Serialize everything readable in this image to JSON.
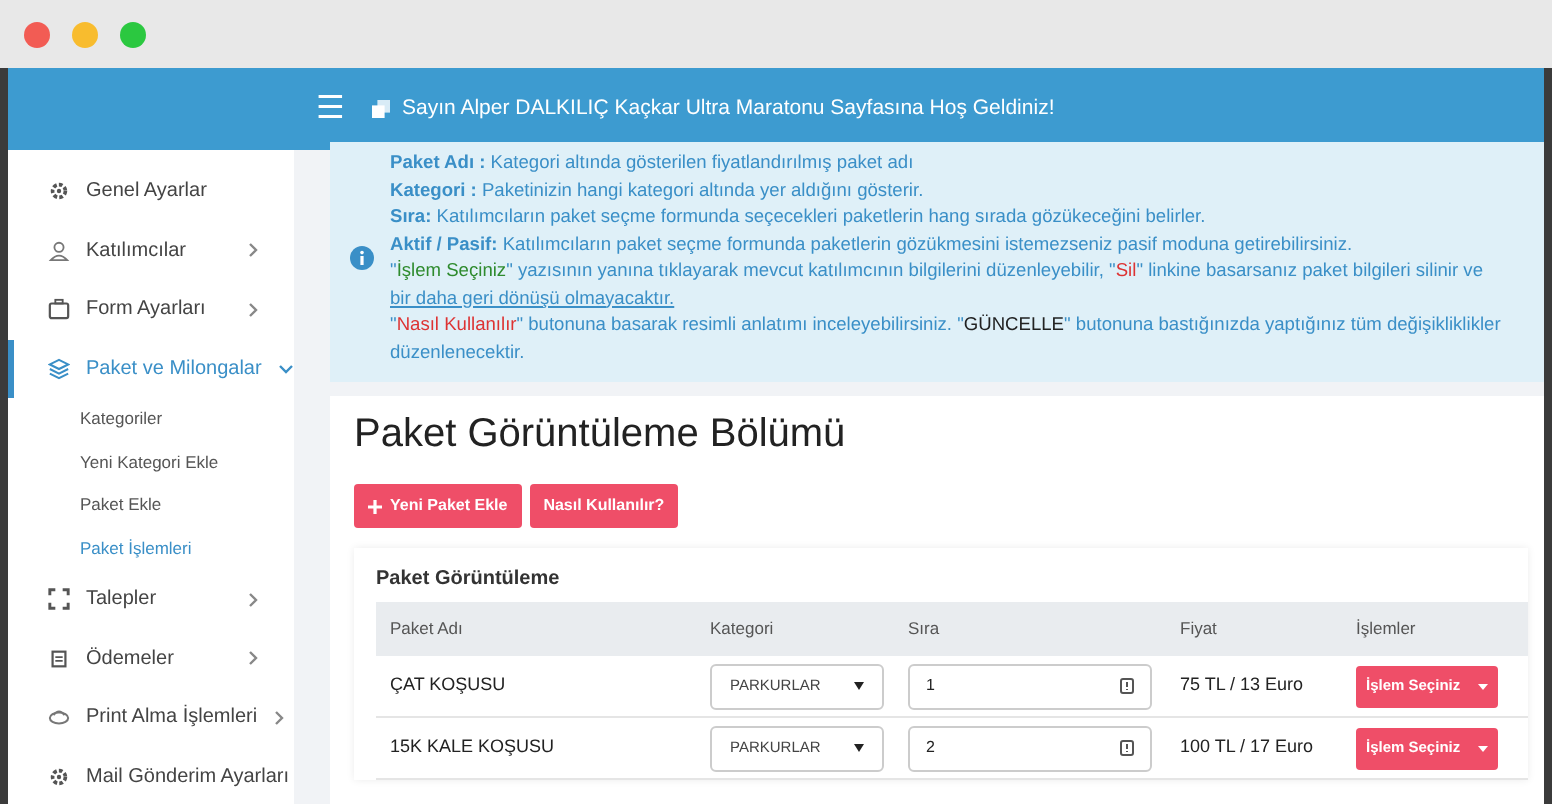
{
  "header": {
    "menu_icon": "☰",
    "welcome": "Sayın Alper DALKILIÇ Kaçkar Ultra Maratonu Sayfasına Hoş Geldiniz!"
  },
  "sidebar": {
    "items": [
      {
        "label": "Genel Ayarlar",
        "selected": false
      },
      {
        "label": "Katılımcılar",
        "selected": false,
        "expanded": false
      },
      {
        "label": "Form Ayarları",
        "selected": false,
        "expanded": false
      },
      {
        "label": "Paket ve Milongalar",
        "selected": true,
        "expanded": true,
        "children": [
          {
            "label": "Kategoriler",
            "selected": false
          },
          {
            "label": "Yeni Kategori Ekle",
            "selected": false
          },
          {
            "label": "Paket Ekle",
            "selected": false
          },
          {
            "label": "Paket İşlemleri",
            "selected": true
          }
        ]
      },
      {
        "label": "Talepler",
        "selected": false,
        "expanded": false
      },
      {
        "label": "Ödemeler",
        "selected": false,
        "expanded": false
      },
      {
        "label": "Print Alma İşlemleri",
        "selected": false,
        "expanded": false
      },
      {
        "label": "Mail Gönderim Ayarları",
        "selected": false
      }
    ]
  },
  "info": {
    "lines": [
      [
        {
          "kind": "label",
          "text": "Paket Adı :"
        },
        {
          "kind": "plain",
          "text": " Kategori altında gösterilen fiyatlandırılmış paket adı"
        }
      ],
      [
        {
          "kind": "label",
          "text": "Kategori :"
        },
        {
          "kind": "plain",
          "text": " Paketinizin hangi kategori altında yer aldığını gösterir."
        }
      ],
      [
        {
          "kind": "label",
          "text": "Sıra:"
        },
        {
          "kind": "plain",
          "text": " Katılımcıların paket seçme formunda seçecekleri paketlerin hang sırada gözükeceğini belirler."
        }
      ],
      [
        {
          "kind": "label",
          "text": "Aktif / Pasif:"
        },
        {
          "kind": "plain",
          "text": " Katılımcıların paket seçme formunda paketlerin gözükmesini istemezseniz pasif moduna getirebilirsiniz."
        }
      ],
      [
        {
          "kind": "plain",
          "text": "\""
        },
        {
          "kind": "green",
          "text": "İşlem Seçiniz"
        },
        {
          "kind": "plain",
          "text": "\" yazısının yanına tıklayarak mevcut katılımcının bilgilerini düzenleyebilir, \""
        },
        {
          "kind": "red",
          "text": "Sil"
        },
        {
          "kind": "plain",
          "text": "\" linkine basarsanız paket bilgileri silinir ve "
        },
        {
          "kind": "link",
          "text": "bir daha geri dönüşü olmayacaktır."
        }
      ],
      [
        {
          "kind": "plain",
          "text": "\""
        },
        {
          "kind": "red",
          "text": "Nasıl Kullanılır"
        },
        {
          "kind": "plain",
          "text": "\" butonuna basarak resimli anlatımı inceleyebilirsiniz. \""
        },
        {
          "kind": "dark",
          "text": "GÜNCELLE"
        },
        {
          "kind": "plain",
          "text": "\" butonuna bastığınızda yaptığınız tüm değişikliklikler düzenlenecektir."
        }
      ]
    ]
  },
  "page": {
    "title": "Paket Görüntüleme Bölümü",
    "buttons": [
      {
        "kind": "add",
        "label": "Yeni Paket Ekle"
      },
      {
        "kind": "help",
        "label": "Nasıl Kullanılır?"
      }
    ]
  },
  "table": {
    "title": "Paket Görüntüleme",
    "columns": [
      "Paket Adı",
      "Kategori",
      "Sıra",
      "Fiyat",
      "İşlemler"
    ],
    "rows": [
      {
        "name": "ÇAT KOŞUSU",
        "category": "PARKURLAR",
        "order": "1",
        "price": "75 TL / 13 Euro",
        "action": "İşlem Seçiniz"
      },
      {
        "name": "15K KALE KOŞUSU",
        "category": "PARKURLAR",
        "order": "2",
        "price": "100 TL / 17 Euro",
        "action": "İşlem Seçiniz"
      }
    ]
  }
}
